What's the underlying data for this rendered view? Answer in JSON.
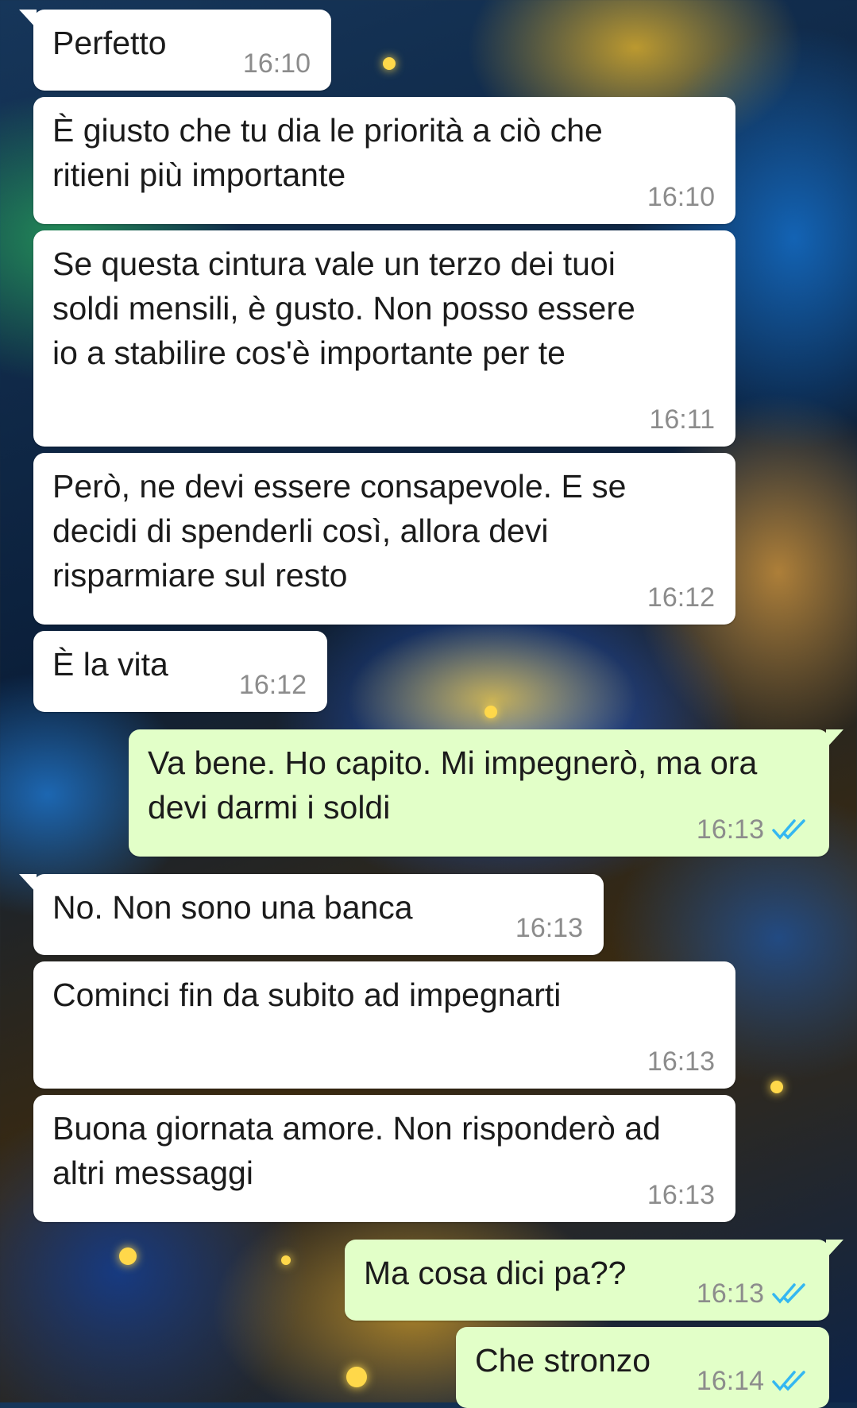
{
  "chat": {
    "messages": [
      {
        "text": "Perfetto",
        "time": "16:10"
      },
      {
        "text": "È giusto che tu dia le priorità a ciò che ritieni più importante",
        "time": "16:10"
      },
      {
        "text": "Se questa cintura vale un terzo dei tuoi soldi mensili, è gusto. Non posso essere io a stabilire cos'è importante per te",
        "time": "16:11"
      },
      {
        "text": "Però, ne devi essere consapevole. E se decidi di spenderli così, allora devi risparmiare sul resto",
        "time": "16:12"
      },
      {
        "text": "È la vita",
        "time": "16:12"
      },
      {
        "text": "Va bene. Ho capito. Mi impegnerò, ma ora devi darmi i soldi",
        "time": "16:13",
        "status_icon": "double-check-read-icon"
      },
      {
        "text": "No. Non sono una banca",
        "time": "16:13"
      },
      {
        "text": "Cominci fin da subito ad impegnarti",
        "time": "16:13"
      },
      {
        "text": "Buona giornata amore. Non risponderò ad altri messaggi",
        "time": "16:13"
      },
      {
        "text": "Ma cosa dici pa??",
        "time": "16:13",
        "status_icon": "double-check-read-icon"
      },
      {
        "text": "Che stronzo",
        "time": "16:14",
        "status_icon": "double-check-read-icon"
      }
    ]
  },
  "colors": {
    "incoming_bubble": "#ffffff",
    "outgoing_bubble": "#e2ffc8",
    "read_tick": "#34b7f1",
    "timestamp": "#8c8c8c"
  }
}
